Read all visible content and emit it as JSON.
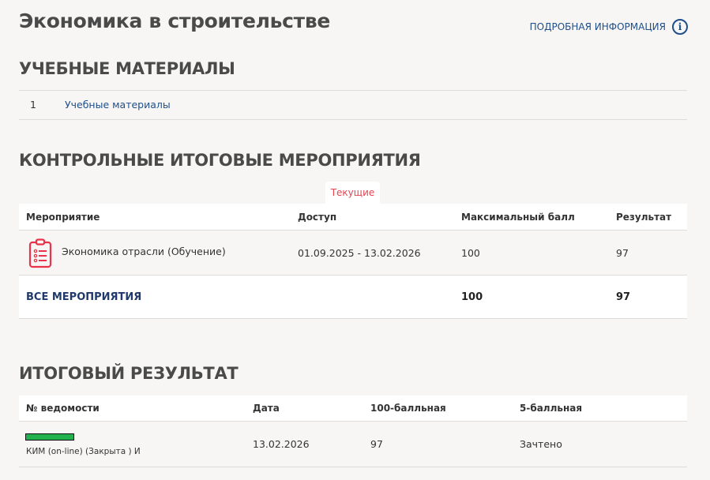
{
  "title": "Экономика в строительстве",
  "info_link": "ПОДРОБНАЯ ИНФОРМАЦИЯ",
  "materials": {
    "heading": "УЧЕБНЫЕ МАТЕРИАЛЫ",
    "items": [
      {
        "num": "1",
        "label": "Учебные материалы"
      }
    ]
  },
  "control": {
    "heading": "КОНТРОЛЬНЫЕ ИТОГОВЫЕ МЕРОПРИЯТИЯ",
    "tab": "Текущие",
    "columns": [
      "Мероприятие",
      "Доступ",
      "Максимальный балл",
      "Результат"
    ],
    "rows": [
      {
        "name": "Экономика отрасли (Обучение)",
        "access": "01.09.2025 - 13.02.2026",
        "max": "100",
        "result": "97"
      }
    ],
    "total": {
      "label": "ВСЕ МЕРОПРИЯТИЯ",
      "max": "100",
      "result": "97"
    }
  },
  "final": {
    "heading": "ИТОГОВЫЙ РЕЗУЛЬТАТ",
    "columns": [
      "№ ведомости",
      "Дата",
      "100-балльная",
      "5-балльная"
    ],
    "rows": [
      {
        "progress": 1.0,
        "progress_color": "#22b14c",
        "name": "КИМ (on-line) (Закрыта ) И",
        "date": "13.02.2026",
        "score100": "97",
        "score5": "Зачтено"
      }
    ]
  }
}
